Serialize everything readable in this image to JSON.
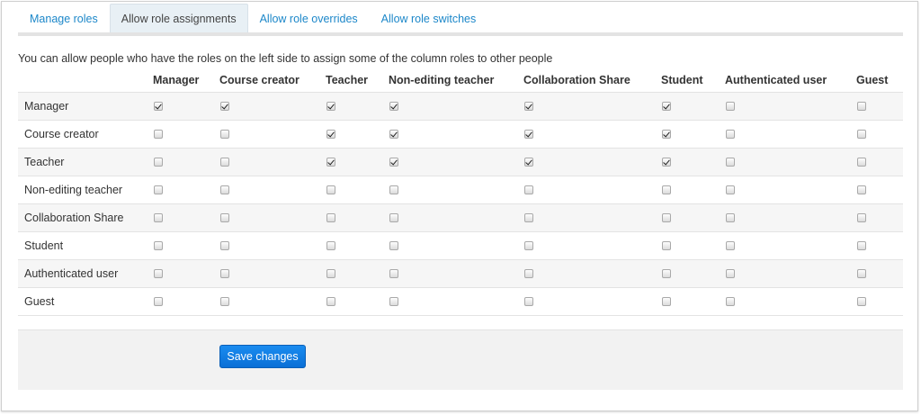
{
  "tabs": [
    {
      "label": "Manage roles",
      "active": false
    },
    {
      "label": "Allow role assignments",
      "active": true
    },
    {
      "label": "Allow role overrides",
      "active": false
    },
    {
      "label": "Allow role switches",
      "active": false
    }
  ],
  "intro": "You can allow people who have the roles on the left side to assign some of the column roles to other people",
  "columns": [
    "Manager",
    "Course creator",
    "Teacher",
    "Non-editing teacher",
    "Collaboration Share",
    "Student",
    "Authenticated user",
    "Guest"
  ],
  "rows": [
    {
      "label": "Manager",
      "checks": [
        true,
        true,
        true,
        true,
        true,
        true,
        false,
        false
      ]
    },
    {
      "label": "Course creator",
      "checks": [
        false,
        false,
        true,
        true,
        true,
        true,
        false,
        false
      ]
    },
    {
      "label": "Teacher",
      "checks": [
        false,
        false,
        true,
        true,
        true,
        true,
        false,
        false
      ]
    },
    {
      "label": "Non-editing teacher",
      "checks": [
        false,
        false,
        false,
        false,
        false,
        false,
        false,
        false
      ]
    },
    {
      "label": "Collaboration Share",
      "checks": [
        false,
        false,
        false,
        false,
        false,
        false,
        false,
        false
      ]
    },
    {
      "label": "Student",
      "checks": [
        false,
        false,
        false,
        false,
        false,
        false,
        false,
        false
      ]
    },
    {
      "label": "Authenticated user",
      "checks": [
        false,
        false,
        false,
        false,
        false,
        false,
        false,
        false
      ]
    },
    {
      "label": "Guest",
      "checks": [
        false,
        false,
        false,
        false,
        false,
        false,
        false,
        false
      ]
    }
  ],
  "save_button": "Save changes",
  "colors": {
    "link": "#1c87c9",
    "button": "#0a6fd6"
  }
}
